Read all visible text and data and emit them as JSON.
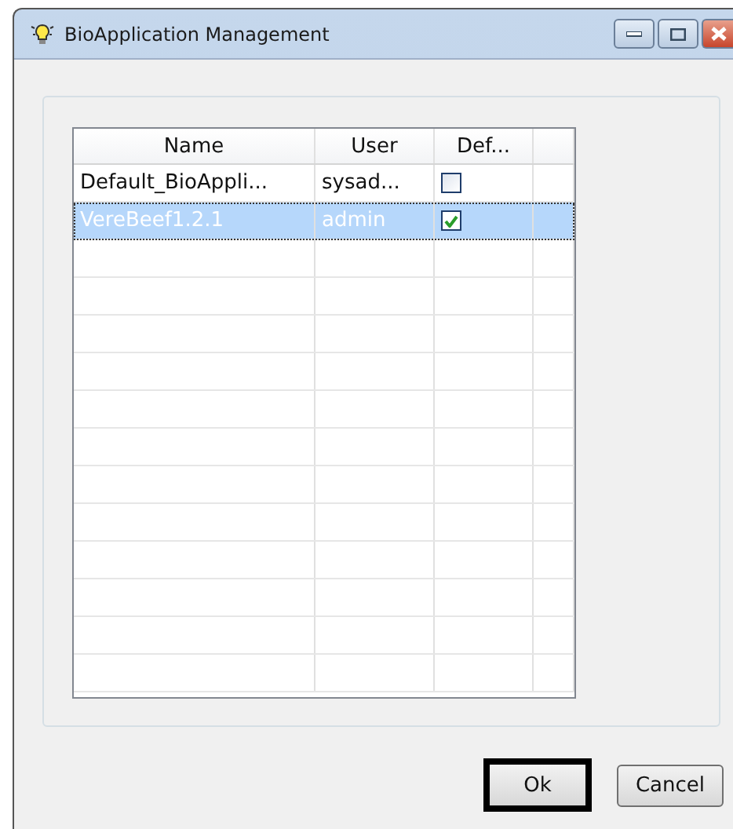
{
  "window": {
    "title": "BioApplication Management"
  },
  "table": {
    "columns": [
      "Name",
      "User",
      "Def..."
    ],
    "rows": [
      {
        "name": "Default_BioAppli...",
        "user": "sysad...",
        "default_checked": false,
        "selected": false
      },
      {
        "name": "VereBeef1.2.1",
        "user": "admin",
        "default_checked": true,
        "selected": true
      }
    ]
  },
  "buttons": [
    {
      "label": "Ok",
      "focused": true
    },
    {
      "label": "Cancel",
      "focused": false
    }
  ]
}
